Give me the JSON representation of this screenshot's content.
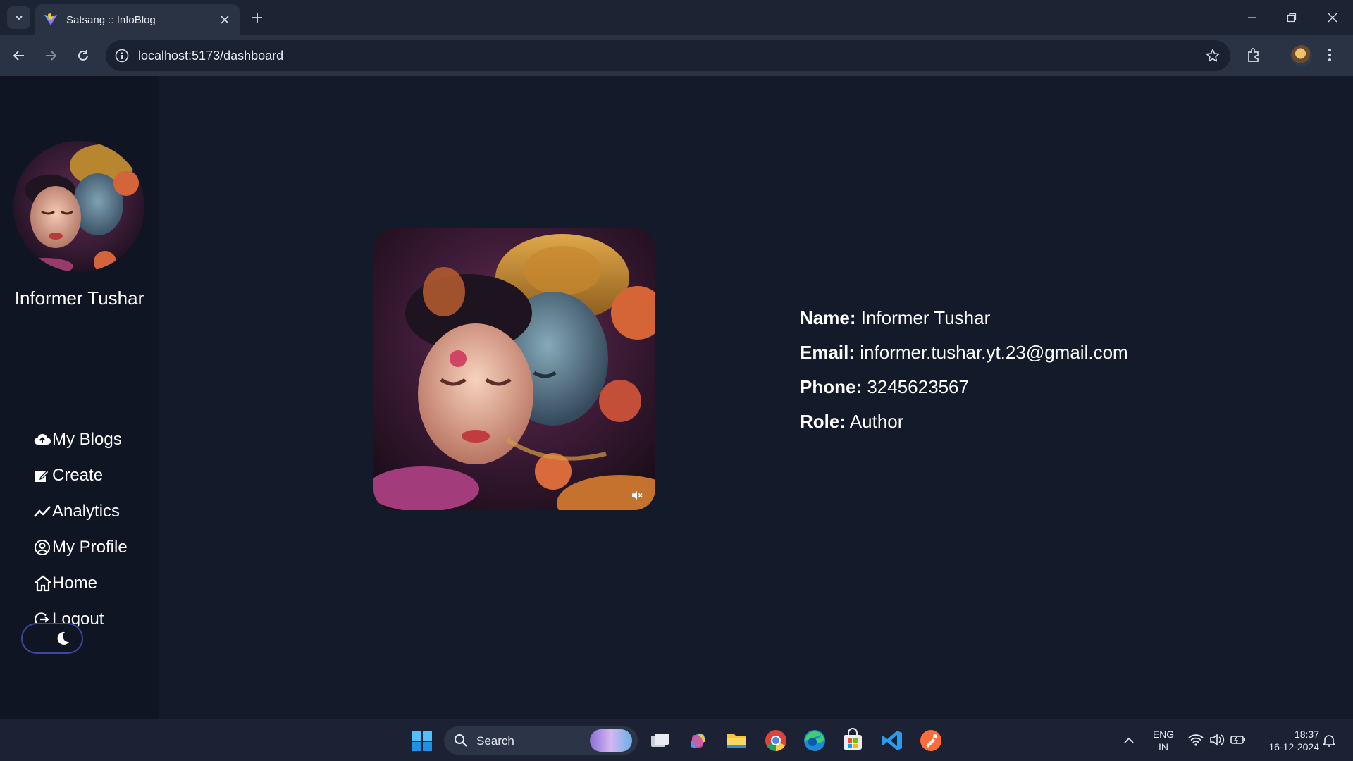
{
  "browser": {
    "tab_title": "Satsang :: InfoBlog",
    "url": "localhost:5173/dashboard"
  },
  "sidebar": {
    "user_name": "Informer Tushar",
    "items": [
      {
        "label": "My Blogs",
        "icon": "cloud-upload-icon"
      },
      {
        "label": "Create",
        "icon": "edit-icon"
      },
      {
        "label": "Analytics",
        "icon": "chart-line-icon"
      },
      {
        "label": "My Profile",
        "icon": "user-circle-icon"
      },
      {
        "label": "Home",
        "icon": "home-icon"
      },
      {
        "label": "Logout",
        "icon": "logout-icon"
      }
    ],
    "theme_toggle_icon": "moon-icon"
  },
  "profile": {
    "name_label": "Name:",
    "name_value": "Informer Tushar",
    "email_label": "Email:",
    "email_value": "informer.tushar.yt.23@gmail.com",
    "phone_label": "Phone:",
    "phone_value": "3245623567",
    "role_label": "Role:",
    "role_value": "Author"
  },
  "taskbar": {
    "search_label": "Search",
    "lang_top": "ENG",
    "lang_bottom": "IN",
    "time": "18:37",
    "date": "16-12-2024"
  },
  "colors": {
    "page_bg": "#131a2a",
    "sidebar_bg": "#0f1523",
    "toggle_border": "#3b4a9e"
  }
}
